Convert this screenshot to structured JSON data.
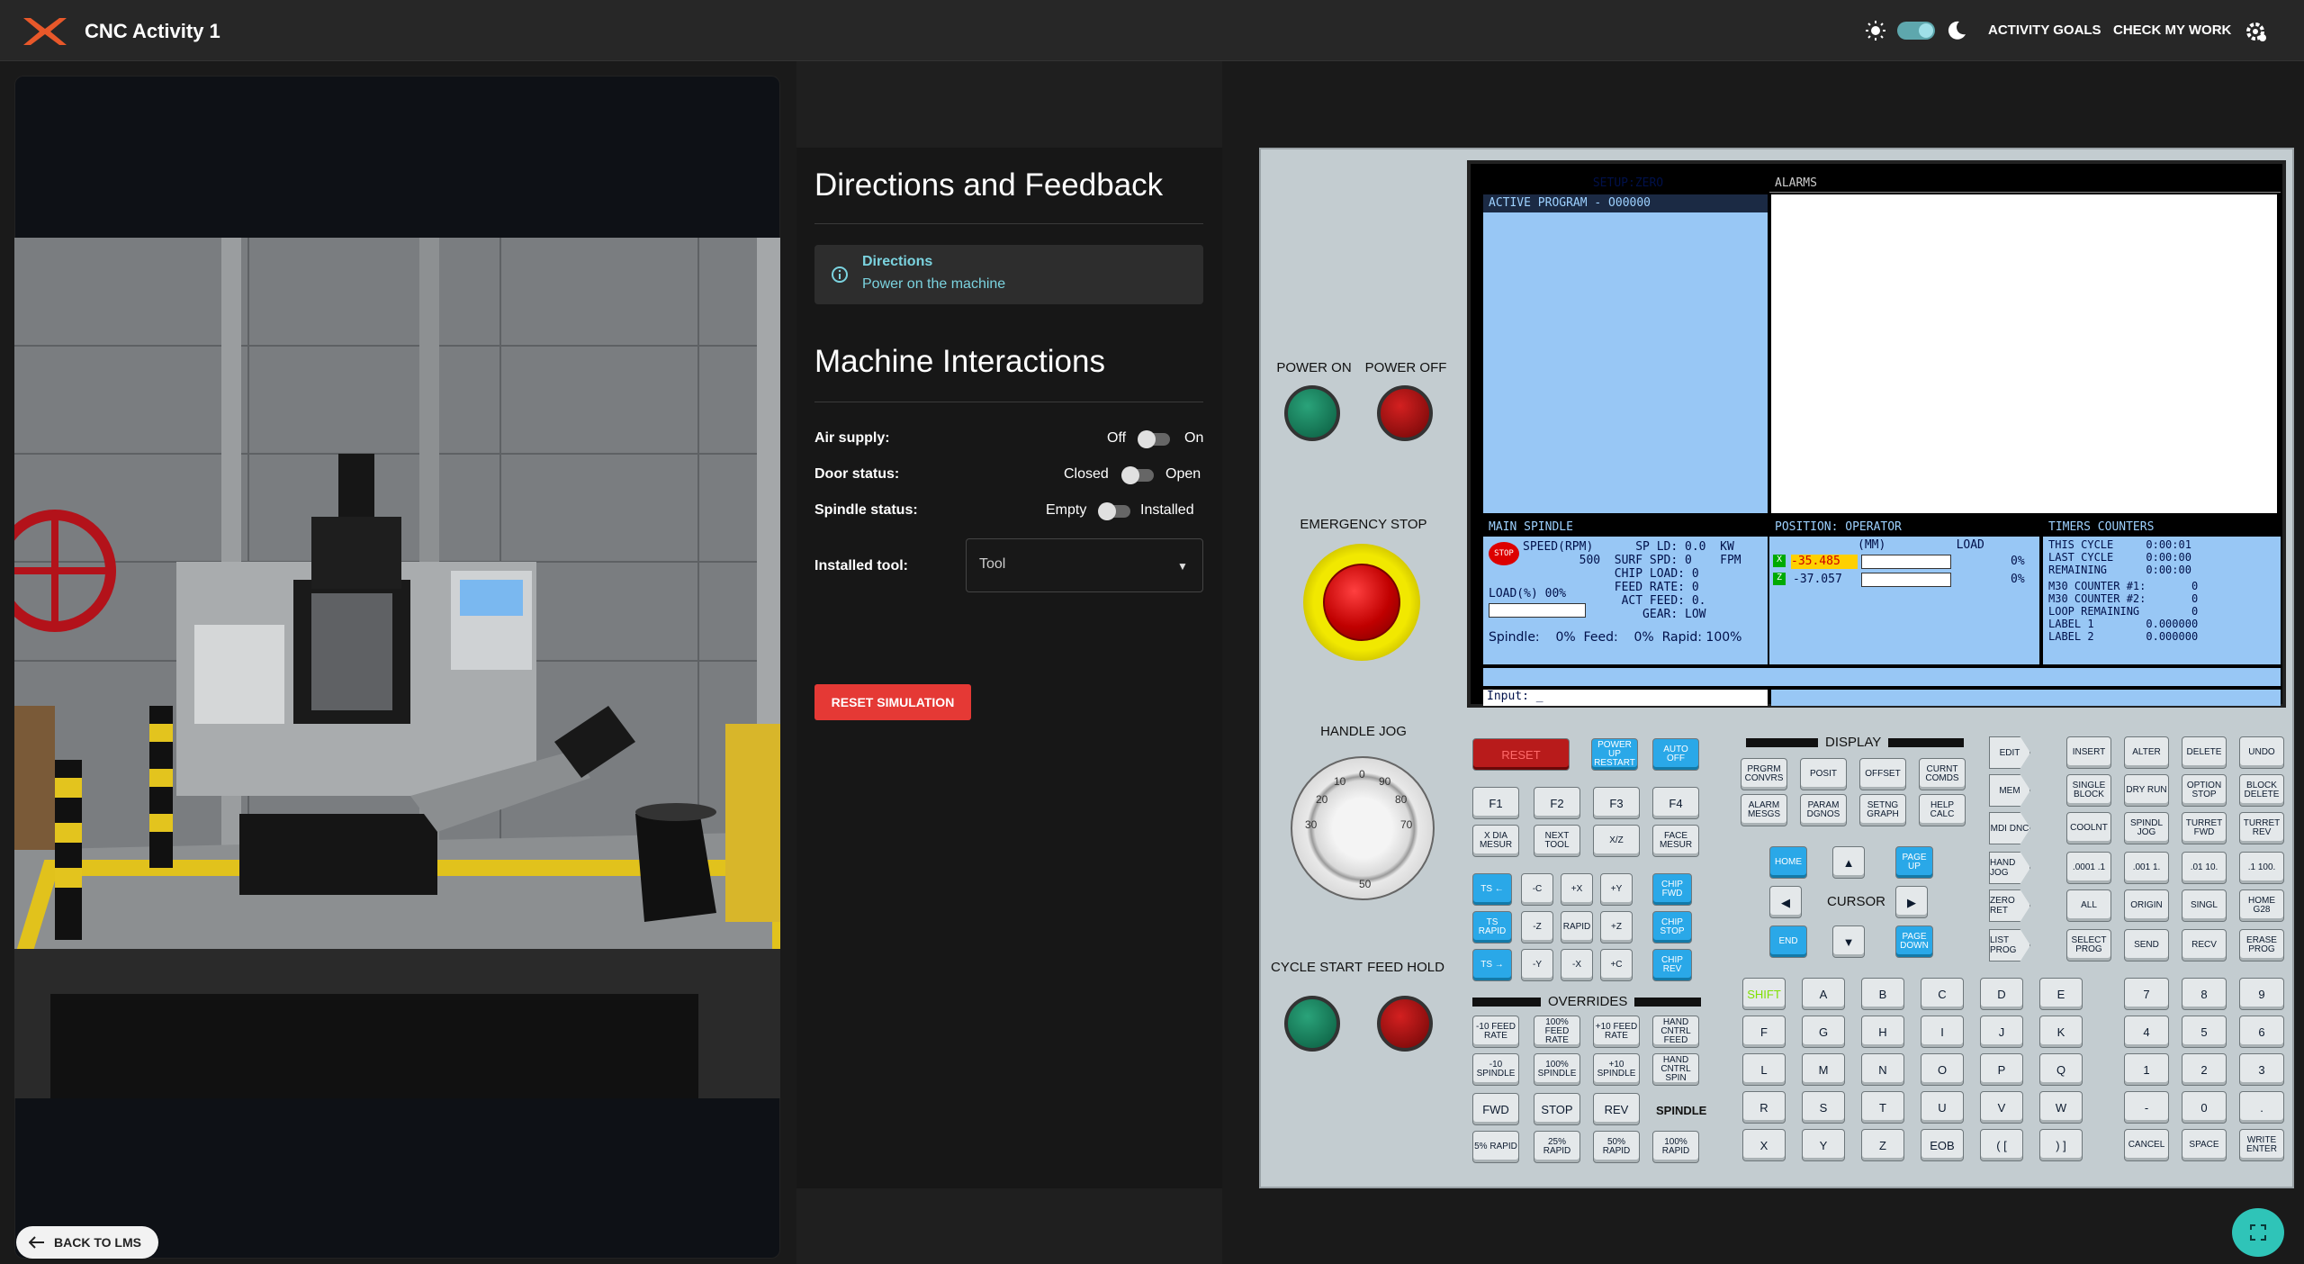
{
  "app": {
    "title": "CNC Activity 1",
    "accent": "#e8582a"
  },
  "header": {
    "activity_goals": "ACTIVITY GOALS",
    "check_my_work": "CHECK MY WORK"
  },
  "viewport": {
    "back_label": "BACK TO LMS"
  },
  "directions": {
    "title": "Directions and Feedback",
    "box_heading": "Directions",
    "box_text": "Power on the machine"
  },
  "interactions": {
    "title": "Machine Interactions",
    "air": {
      "label": "Air supply:",
      "off": "Off",
      "on": "On",
      "state": "Off"
    },
    "door": {
      "label": "Door status:",
      "off": "Closed",
      "on": "Open",
      "state": "Closed"
    },
    "spindle": {
      "label": "Spindle status:",
      "off": "Empty",
      "on": "Installed",
      "state": "Empty"
    },
    "tool": {
      "label": "Installed tool:",
      "value": "Tool"
    },
    "reset": "RESET SIMULATION"
  },
  "panel": {
    "power_on": "POWER ON",
    "power_off": "POWER OFF",
    "emergency_stop": "EMERGENCY STOP",
    "handle_jog": "HANDLE JOG",
    "cycle_start": "CYCLE START",
    "feed_hold": "FEED HOLD",
    "display_label": "DISPLAY",
    "cursor_label": "CURSOR",
    "overrides_label": "OVERRIDES",
    "spindle_label": "SPINDLE"
  },
  "screen": {
    "setup": "SETUP:ZERO",
    "alarms": "ALARMS",
    "active_program": "ACTIVE PROGRAM - O00000",
    "main_spindle": "MAIN SPINDLE",
    "position": "POSITION: OPERATOR",
    "timers": "TIMERS  COUNTERS",
    "stop": "STOP",
    "spindle_lines": [
      "SPEED(RPM)      SP LD: 0.0  KW",
      "        500  SURF SPD: 0    FPM",
      "             CHIP LOAD: 0",
      "             FEED RATE: 0",
      "              ACT FEED: 0.",
      "                 GEAR: LOW"
    ],
    "load_pct": "LOAD(%)  00%",
    "pos_header": "(MM)          LOAD",
    "pos_x": "-35.485",
    "pos_z": "-37.057",
    "pos_load_x": "0%",
    "pos_load_z": "0%",
    "timers_lines": [
      "THIS CYCLE     0:00:01",
      "LAST CYCLE     0:00:00",
      "REMAINING      0:00:00",
      "M30 COUNTER #1:       0",
      "M30 COUNTER #2:       0",
      "LOOP REMAINING        0",
      "LABEL 1        0.000000",
      "LABEL 2        0.000000"
    ],
    "status_line": "Spindle:    0%  Feed:    0%  Rapid: 100%",
    "input": "Input: _"
  },
  "keys": {
    "row_top": [
      "RESET",
      "POWER UP RESTART",
      "AUTO OFF"
    ],
    "fkeys": [
      "F1",
      "F2",
      "F3",
      "F4"
    ],
    "row_tool": [
      "X DIA MESUR",
      "NEXT TOOL",
      "X/Z",
      "FACE MESUR"
    ],
    "jog1": [
      "TS ←",
      "-C",
      "+X",
      "+Y",
      "CHIP FWD"
    ],
    "jog2": [
      "TS RAPID",
      "-Z",
      "RAPID",
      "+Z",
      "CHIP STOP"
    ],
    "jog3": [
      "TS →",
      "-Y",
      "-X",
      "+C",
      "CHIP REV"
    ],
    "ovr1": [
      "-10 FEED RATE",
      "100% FEED RATE",
      "+10 FEED RATE",
      "HAND CNTRL FEED"
    ],
    "ovr2": [
      "-10 SPINDLE",
      "100% SPINDLE",
      "+10 SPINDLE",
      "HAND CNTRL SPIN"
    ],
    "ovr3": [
      "FWD",
      "STOP",
      "REV"
    ],
    "ovr4": [
      "5% RAPID",
      "25% RAPID",
      "50% RAPID",
      "100% RAPID"
    ],
    "disp1": [
      "PRGRM CONVRS",
      "POSIT",
      "OFFSET",
      "CURNT COMDS"
    ],
    "disp2": [
      "ALARM MESGS",
      "PARAM DGNOS",
      "SETNG GRAPH",
      "HELP CALC"
    ],
    "cursor": [
      "HOME",
      "▲",
      "PAGE UP",
      "◀",
      "▶",
      "END",
      "▼",
      "PAGE DOWN"
    ],
    "mode": [
      "EDIT",
      "MEM",
      "MDI DNC",
      "HAND JOG",
      "ZERO RET",
      "LIST PROG"
    ],
    "edit": [
      "INSERT",
      "ALTER",
      "DELETE",
      "UNDO"
    ],
    "mem": [
      "SINGLE BLOCK",
      "DRY RUN",
      "OPTION STOP",
      "BLOCK DELETE"
    ],
    "mdi": [
      "COOLNT",
      "SPINDL JOG",
      "TURRET FWD",
      "TURRET REV"
    ],
    "hand": [
      ".0001 .1",
      ".001 1.",
      ".01 10.",
      ".1 100."
    ],
    "zero": [
      "ALL",
      "ORIGIN",
      "SINGL",
      "HOME G28"
    ],
    "list": [
      "SELECT PROG",
      "SEND",
      "RECV",
      "ERASE PROG"
    ],
    "alpha1": [
      "SHIFT",
      "A",
      "B",
      "C",
      "D",
      "E"
    ],
    "alpha2": [
      "F",
      "G",
      "H",
      "I",
      "J",
      "K"
    ],
    "alpha3": [
      "L",
      "M",
      "N",
      "O",
      "P",
      "Q"
    ],
    "alpha4": [
      "R",
      "S",
      "T",
      "U",
      "V",
      "W"
    ],
    "alpha5": [
      "X",
      "Y",
      "Z",
      "EOB",
      "( [",
      ") ]"
    ],
    "num1": [
      "7",
      "8",
      "9"
    ],
    "num2": [
      "4",
      "5",
      "6"
    ],
    "num3": [
      "1",
      "2",
      "3"
    ],
    "num4": [
      "-",
      "0",
      "."
    ],
    "num5": [
      "CANCEL",
      "SPACE",
      "WRITE ENTER"
    ]
  }
}
